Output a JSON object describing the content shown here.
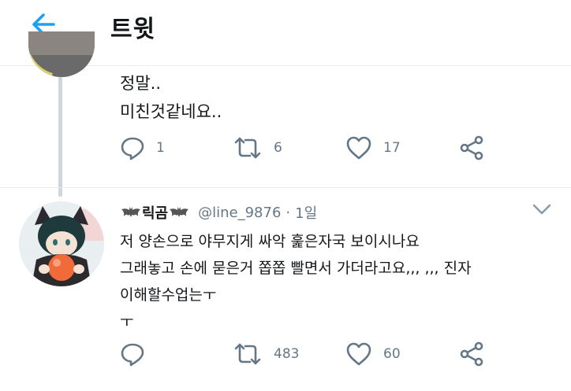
{
  "header": {
    "title": "트윗",
    "back_icon": "arrow-left-icon",
    "accent_color": "#1da1f2"
  },
  "tweet1": {
    "text": "정말..\n미친것같네요..",
    "actions": {
      "reply_count": "1",
      "retweet_count": "6",
      "like_count": "17"
    }
  },
  "tweet2": {
    "display_name": "릭곰",
    "handle": "@line_9876",
    "separator": "·",
    "time": "1일",
    "text": "저 양손으로 야무지게 싸악 훑은자국 보이시나요\n그래놓고 손에 묻은거 쫍쫍 빨면서 가더라고요,,,  ,,,  진자\n이해할수업는ㅜ\nㅜ",
    "actions": {
      "reply_count": "",
      "retweet_count": "483",
      "like_count": "60"
    }
  },
  "icons": {
    "reply": "reply-icon",
    "retweet": "retweet-icon",
    "like": "heart-icon",
    "share": "share-icon",
    "menu": "chevron-down-icon",
    "decoration": "bat-icon"
  }
}
